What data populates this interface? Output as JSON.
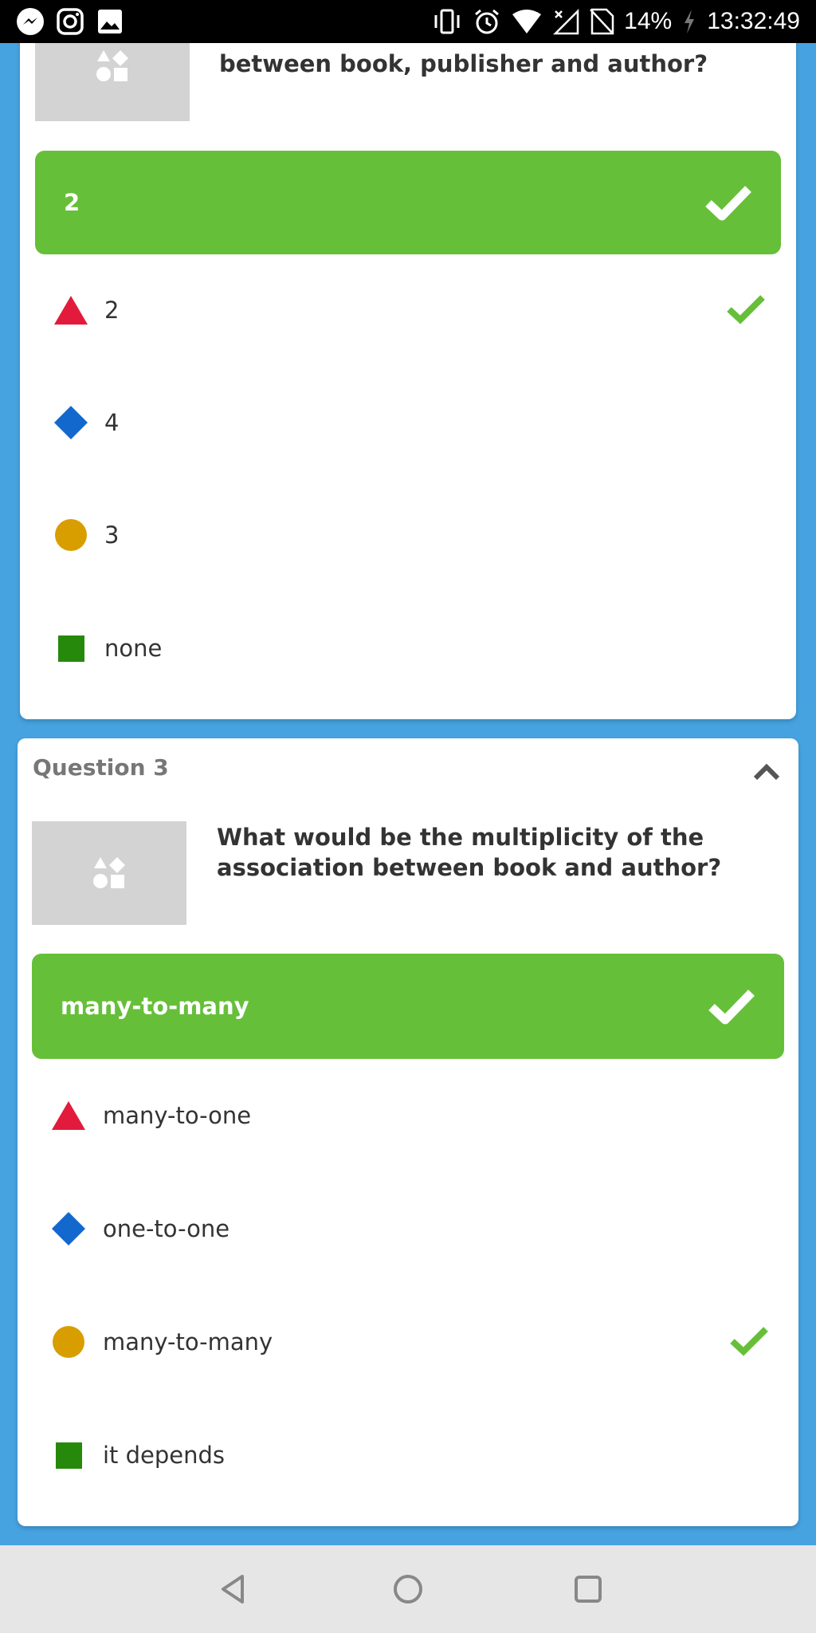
{
  "status_bar": {
    "battery": "14%",
    "time": "13:32:49",
    "left_icons": [
      "messenger-icon",
      "instagram-icon",
      "gallery-icon"
    ],
    "right_icons": [
      "vibrate-icon",
      "alarm-icon",
      "wifi-icon",
      "no-signal-icon",
      "no-sim-icon",
      "charging-icon"
    ]
  },
  "question2": {
    "question_text": "How many associations could you create between book, publisher and author?",
    "question_text_visible_line": "between book, publisher and author?",
    "correct_answer": "2",
    "options": [
      {
        "shape": "triangle",
        "label": "2",
        "correct": true
      },
      {
        "shape": "diamond",
        "label": "4",
        "correct": false
      },
      {
        "shape": "circle",
        "label": "3",
        "correct": false
      },
      {
        "shape": "square",
        "label": "none",
        "correct": false
      }
    ]
  },
  "question3": {
    "header": "Question 3",
    "question_text": "What would be the multiplicity of the association between book and author?",
    "question_line1": "What would be the multiplicity of the",
    "question_line2": "association between book and author?",
    "correct_answer": "many-to-many",
    "options": [
      {
        "shape": "triangle",
        "label": "many-to-one",
        "correct": false
      },
      {
        "shape": "diamond",
        "label": "one-to-one",
        "correct": false
      },
      {
        "shape": "circle",
        "label": "many-to-many",
        "correct": true
      },
      {
        "shape": "square",
        "label": "it depends",
        "correct": false
      }
    ]
  },
  "colors": {
    "background": "#46a3e0",
    "correct_green": "#66bf39",
    "triangle_red": "#e21b3c",
    "diamond_blue": "#1368ce",
    "circle_gold": "#d89e00",
    "square_green": "#26890c"
  },
  "nav_bar": {
    "buttons": [
      "back-icon",
      "home-icon",
      "recents-icon"
    ]
  }
}
